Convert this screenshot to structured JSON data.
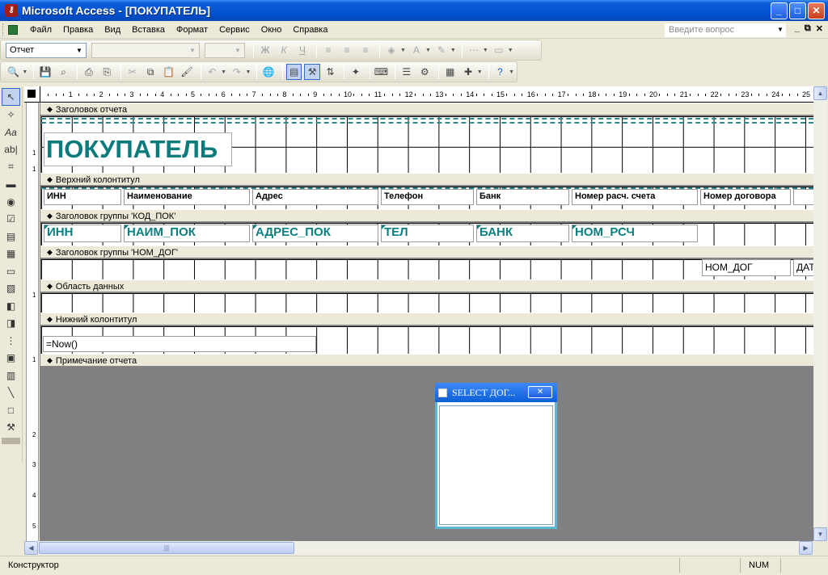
{
  "window": {
    "title": "Microsoft Access - [ПОКУПАТЕЛЬ]",
    "app_icon": "access-key-icon"
  },
  "menu": {
    "items": [
      "Файл",
      "Правка",
      "Вид",
      "Вставка",
      "Формат",
      "Сервис",
      "Окно",
      "Справка"
    ],
    "ask_placeholder": "Введите вопрос"
  },
  "format_toolbar": {
    "object_combo": "Отчет",
    "font_combo": "",
    "size_combo": ""
  },
  "report": {
    "sections": [
      "Заголовок отчета",
      "Верхний колонтитул",
      "Заголовок группы 'КОД_ПОК'",
      "Заголовок группы 'НОМ_ДОГ'",
      "Область данных",
      "Нижний колонтитул",
      "Примечание отчета"
    ],
    "title_label": "ПОКУПАТЕЛЬ",
    "header_labels": [
      "ИНН",
      "Наименование",
      "Адрес",
      "Телефон",
      "Банк",
      "Номер расч. счета",
      "Номер договора"
    ],
    "group1_fields": [
      "ИНН",
      "НАИМ_ПОК",
      "АДРЕС_ПОК",
      "ТЕЛ",
      "БАНК",
      "НОМ_РСЧ"
    ],
    "group2_fields": [
      "НОМ_ДОГ",
      "ДАТ"
    ],
    "footer_expr": "=Now()"
  },
  "ruler": {
    "h": [
      "1",
      "2",
      "3",
      "4",
      "5",
      "6",
      "7",
      "8",
      "9",
      "10",
      "11",
      "12",
      "13",
      "14",
      "15",
      "16",
      "17",
      "18",
      "19",
      "20",
      "21",
      "22",
      "23",
      "24",
      "25"
    ],
    "v": [
      "1",
      "1",
      "1",
      "1",
      "2",
      "3",
      "4",
      "5"
    ]
  },
  "field_list": {
    "title": "SELECT ДОГ..."
  },
  "status": {
    "mode": "Конструктор",
    "num": "NUM"
  }
}
